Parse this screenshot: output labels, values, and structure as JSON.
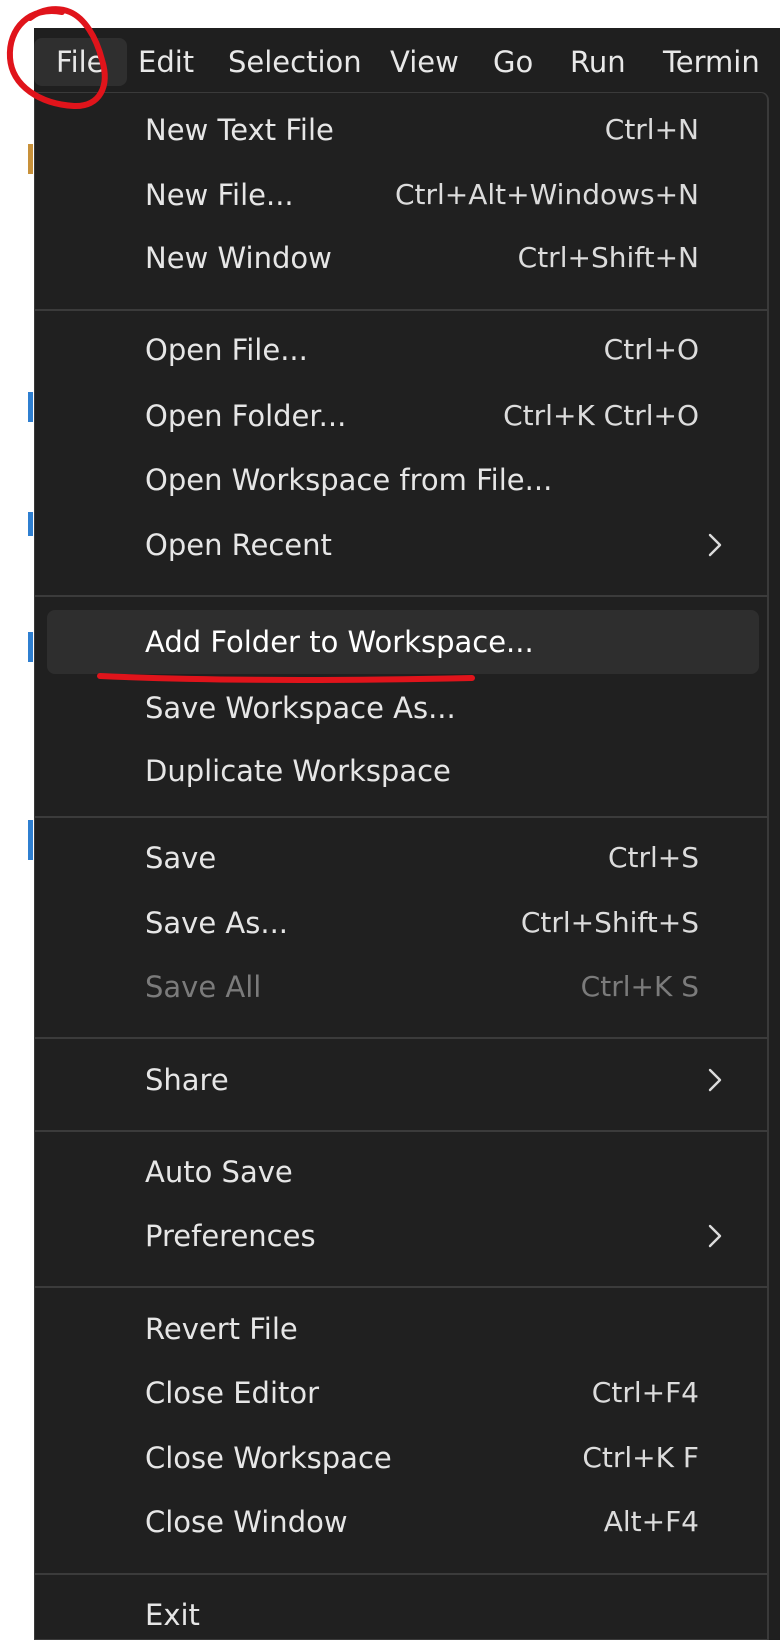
{
  "menubar": {
    "items": [
      {
        "label": "File"
      },
      {
        "label": "Edit"
      },
      {
        "label": "Selection"
      },
      {
        "label": "View"
      },
      {
        "label": "Go"
      },
      {
        "label": "Run"
      },
      {
        "label": "Termin"
      }
    ],
    "active": "File"
  },
  "file_menu": {
    "groups": [
      [
        {
          "label": "New Text File",
          "shortcut": "Ctrl+N"
        },
        {
          "label": "New File...",
          "shortcut": "Ctrl+Alt+Windows+N"
        },
        {
          "label": "New Window",
          "shortcut": "Ctrl+Shift+N"
        }
      ],
      [
        {
          "label": "Open File...",
          "shortcut": "Ctrl+O"
        },
        {
          "label": "Open Folder...",
          "shortcut": "Ctrl+K Ctrl+O"
        },
        {
          "label": "Open Workspace from File...",
          "shortcut": ""
        },
        {
          "label": "Open Recent",
          "shortcut": "",
          "submenu": true
        }
      ],
      [
        {
          "label": "Add Folder to Workspace...",
          "shortcut": "",
          "highlighted": true
        },
        {
          "label": "Save Workspace As...",
          "shortcut": ""
        },
        {
          "label": "Duplicate Workspace",
          "shortcut": ""
        }
      ],
      [
        {
          "label": "Save",
          "shortcut": "Ctrl+S"
        },
        {
          "label": "Save As...",
          "shortcut": "Ctrl+Shift+S"
        },
        {
          "label": "Save All",
          "shortcut": "Ctrl+K S",
          "disabled": true
        }
      ],
      [
        {
          "label": "Share",
          "shortcut": "",
          "submenu": true
        }
      ],
      [
        {
          "label": "Auto Save",
          "shortcut": ""
        },
        {
          "label": "Preferences",
          "shortcut": "",
          "submenu": true
        }
      ],
      [
        {
          "label": "Revert File",
          "shortcut": ""
        },
        {
          "label": "Close Editor",
          "shortcut": "Ctrl+F4"
        },
        {
          "label": "Close Workspace",
          "shortcut": "Ctrl+K F"
        },
        {
          "label": "Close Window",
          "shortcut": "Alt+F4"
        }
      ],
      [
        {
          "label": "Exit",
          "shortcut": ""
        }
      ]
    ]
  },
  "colors": {
    "menu_background": "#202020",
    "text": "#e6e6e6",
    "disabled_text": "#7b7b7b",
    "highlight": "#2e2e2e",
    "annotation": "#e0141b"
  },
  "icons": {
    "submenu": "chevron-right-icon"
  }
}
